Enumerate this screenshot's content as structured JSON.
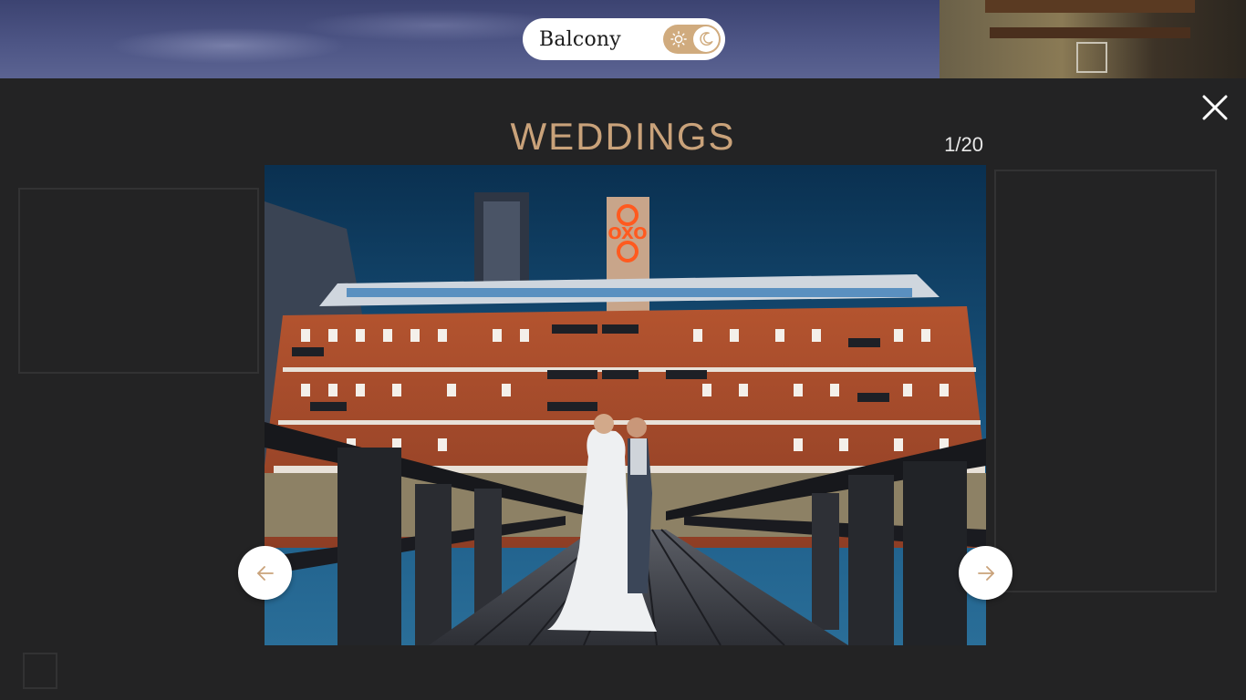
{
  "header": {
    "brand_name": "Balcony",
    "theme_toggle": {
      "light_icon": "sun-icon",
      "dark_icon": "moon-icon",
      "selected": "dark"
    }
  },
  "lightbox": {
    "title": "WEDDINGS",
    "counter": "1/20",
    "close_icon": "close-icon",
    "prev_icon": "arrow-left-icon",
    "next_icon": "arrow-right-icon",
    "image": {
      "subject": "wedding couple on a riverside pier at dusk",
      "sign_text": "OXO"
    }
  },
  "colors": {
    "accent": "#c9a27a",
    "toggle_bg": "#d0ab7e",
    "overlay_bg": "#232324",
    "counter_text": "#e8e8e8"
  }
}
